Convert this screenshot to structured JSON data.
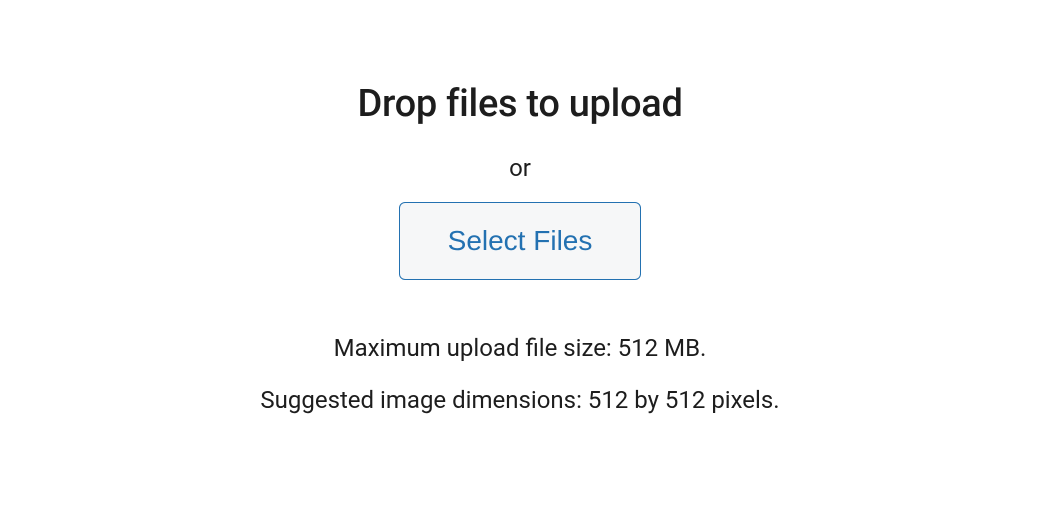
{
  "upload": {
    "heading": "Drop files to upload",
    "or_label": "or",
    "select_button": "Select Files",
    "max_size_text": "Maximum upload file size: 512 MB.",
    "suggested_dimensions_text": "Suggested image dimensions: 512 by 512 pixels."
  }
}
